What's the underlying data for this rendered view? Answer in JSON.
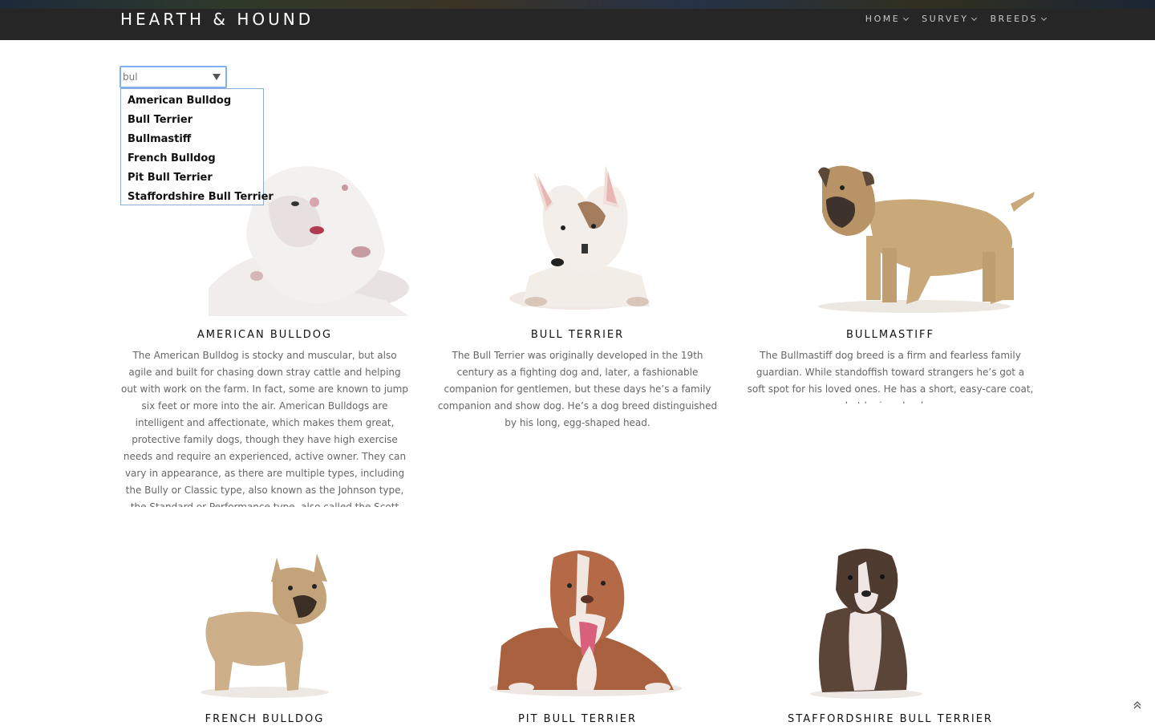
{
  "header": {
    "brand": "HEARTH & HOUND",
    "nav": [
      {
        "label": "HOME"
      },
      {
        "label": "SURVEY"
      },
      {
        "label": "BREEDS"
      }
    ]
  },
  "search": {
    "value": "bul",
    "suggestions": [
      "American Bulldog",
      "Bull Terrier",
      "Bullmastiff",
      "French Bulldog",
      "Pit Bull Terrier",
      "Staffordshire Bull Terrier"
    ]
  },
  "breeds": [
    {
      "name": "AMERICAN BULLDOG",
      "description": "The American Bulldog is stocky and muscular, but also agile and built for chasing down stray cattle and helping out with work on the farm. In fact, some are known to jump six feet or more into the air. American Bulldogs are intelligent and affectionate, which makes them great, protective family dogs, though they have high exercise needs and require an experienced, active owner. They can vary in appearance, as there are multiple types, including the Bully or Classic type, also known as the Johnson type, the Standard or Performance type, also called the Scott type, and hybrids of the two. With patient training and care"
    },
    {
      "name": "BULL TERRIER",
      "description": "The Bull Terrier was originally developed in the 19th century as a fighting dog and, later, a fashionable companion for gentlemen, but these days he’s a family companion and show dog. He’s a dog breed distinguished by his long, egg-shaped head."
    },
    {
      "name": "BULLMASTIFF",
      "description": "The Bullmastiff dog breed is a firm and fearless family guardian. While standoffish toward strangers he’s got a soft spot for his loved ones. He has a short, easy-care coat, but he is a drooler."
    },
    {
      "name": "FRENCH BULLDOG"
    },
    {
      "name": "PIT BULL TERRIER"
    },
    {
      "name": "STAFFORDSHIRE BULL TERRIER"
    }
  ],
  "colors": {
    "header_bg": "#262626",
    "focus_border": "#7fb2f0",
    "body_text": "#666666"
  },
  "icons": {
    "dropdown": "triangle-down",
    "nav_chevron": "chevron-down",
    "scroll_top": "double-chevron-up"
  }
}
